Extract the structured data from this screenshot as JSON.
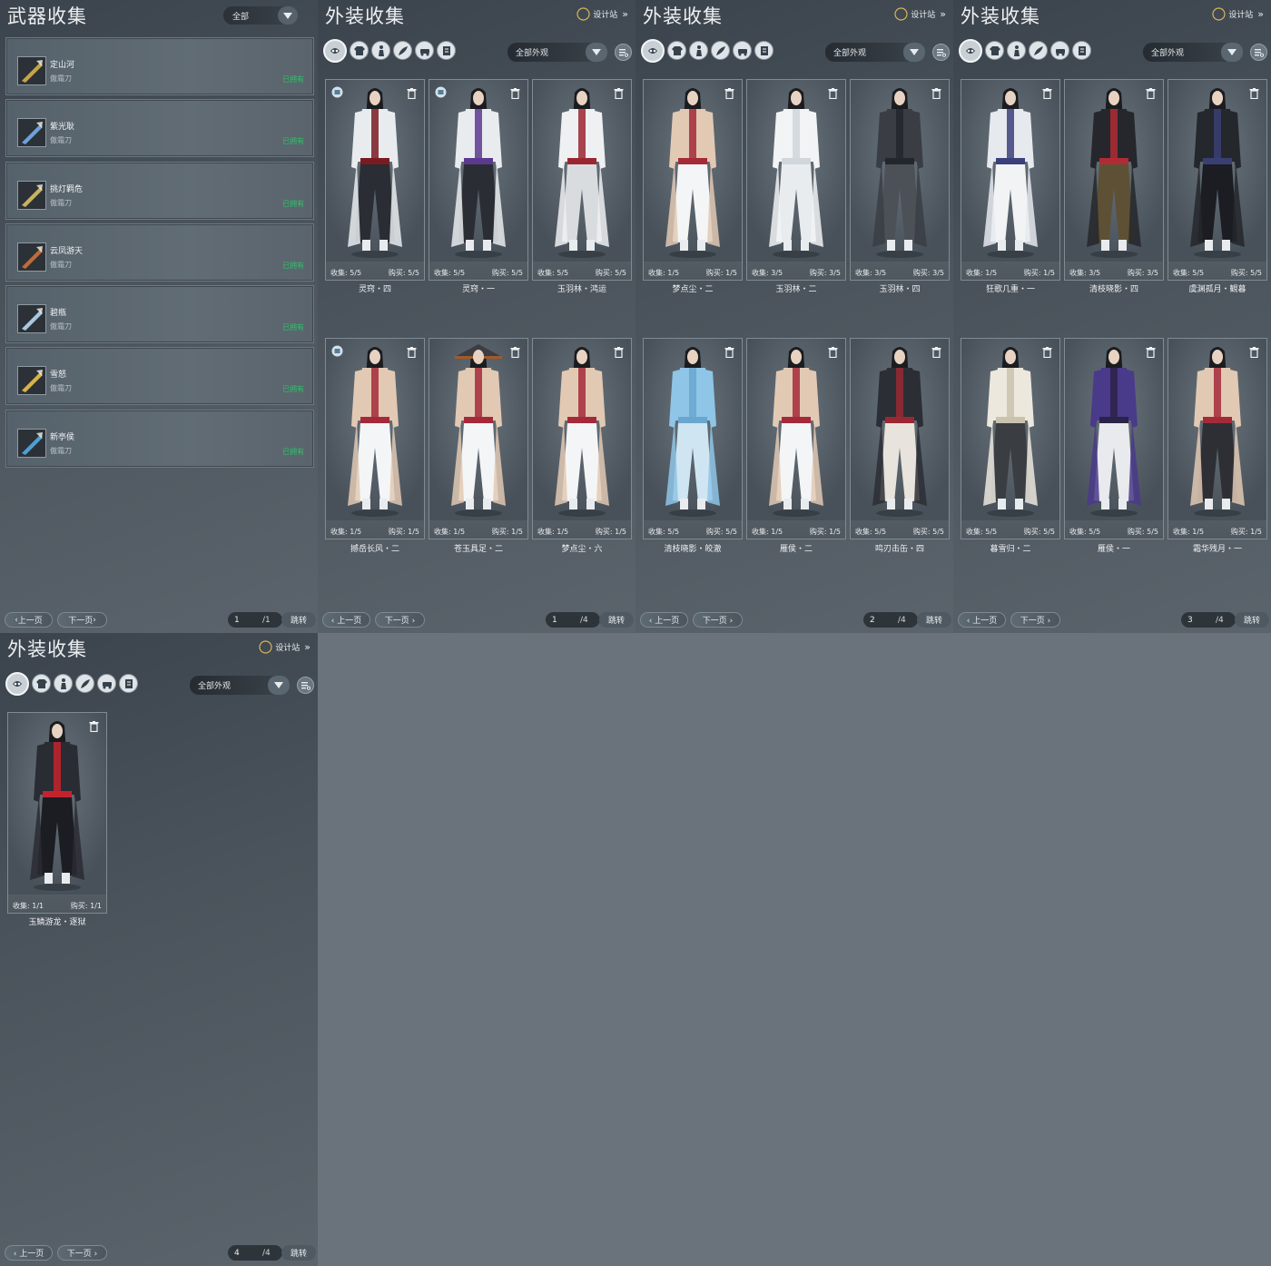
{
  "weapons_panel": {
    "title": "武器收集",
    "filter": "全部",
    "items": [
      {
        "name": "定山河",
        "type": "傲霜刀",
        "status": "已拥有"
      },
      {
        "name": "紫光耿",
        "type": "傲霜刀",
        "status": "已拥有"
      },
      {
        "name": "挑灯羁危",
        "type": "傲霜刀",
        "status": "已拥有"
      },
      {
        "name": "云凤游天",
        "type": "傲霜刀",
        "status": "已拥有"
      },
      {
        "name": "碧瓶",
        "type": "傲霜刀",
        "status": "已拥有"
      },
      {
        "name": "雪怒",
        "type": "傲霜刀",
        "status": "已拥有"
      },
      {
        "name": "新亭侯",
        "type": "傲霜刀",
        "status": "已拥有"
      }
    ],
    "pager": {
      "prev": "上一页",
      "next": "下一页",
      "current": "1",
      "total": "/1",
      "jump": "跳转"
    }
  },
  "outfit_common": {
    "title": "外装收集",
    "designer": "设计站",
    "filter": "全部外观",
    "collect_label": "收集:",
    "buy_label": "购买:",
    "prev": "上一页",
    "next": "下一页",
    "jump": "跳转"
  },
  "outfit_panels": [
    {
      "page": "1",
      "total": "/4",
      "cards": [
        {
          "name": "灵窍・四",
          "collect": "5/5",
          "buy": "5/5",
          "badge": true,
          "palette": [
            "#e9ecef",
            "#7a1b22",
            "#2a2d33"
          ]
        },
        {
          "name": "灵窍・一",
          "collect": "5/5",
          "buy": "5/5",
          "badge": true,
          "palette": [
            "#e9ecef",
            "#5b3a8e",
            "#2a2d33"
          ]
        },
        {
          "name": "玉羽林・鸿运",
          "collect": "5/5",
          "buy": "5/5",
          "badge": false,
          "palette": [
            "#eef0f2",
            "#9b2630",
            "#d9dcdf"
          ]
        },
        {
          "name": "撼岳长风・二",
          "collect": "1/5",
          "buy": "1/5",
          "badge": true,
          "palette": [
            "#e2c9b4",
            "#a42a3a",
            "#f4f5f6"
          ]
        },
        {
          "name": "苍玉具足・二",
          "collect": "1/5",
          "buy": "1/5",
          "badge": false,
          "palette": [
            "#e2c9b4",
            "#a42a3a",
            "#f4f5f6"
          ]
        },
        {
          "name": "梦点尘・六",
          "collect": "1/5",
          "buy": "1/5",
          "badge": false,
          "palette": [
            "#e2c9b4",
            "#a42a3a",
            "#f4f5f6"
          ]
        }
      ]
    },
    {
      "page": "2",
      "total": "/4",
      "cards": [
        {
          "name": "梦点尘・二",
          "collect": "1/5",
          "buy": "1/5",
          "badge": false,
          "palette": [
            "#e2c9b4",
            "#a42a3a",
            "#f4f5f6"
          ]
        },
        {
          "name": "玉羽林・二",
          "collect": "3/5",
          "buy": "3/5",
          "badge": false,
          "palette": [
            "#f1f3f5",
            "#cfd6dc",
            "#e9ecef"
          ]
        },
        {
          "name": "玉羽林・四",
          "collect": "3/5",
          "buy": "3/5",
          "badge": false,
          "palette": [
            "#3a3e44",
            "#23262b",
            "#4c5158"
          ]
        },
        {
          "name": "清枝晓影・皎澈",
          "collect": "5/5",
          "buy": "5/5",
          "badge": false,
          "palette": [
            "#8fc5e6",
            "#6aa6cf",
            "#cfe5f2"
          ]
        },
        {
          "name": "雁侯・二",
          "collect": "1/5",
          "buy": "1/5",
          "badge": false,
          "palette": [
            "#e2c9b4",
            "#a42a3a",
            "#f4f5f6"
          ]
        },
        {
          "name": "鸣刃击缶・四",
          "collect": "5/5",
          "buy": "5/5",
          "badge": false,
          "palette": [
            "#2b2e34",
            "#9a2832",
            "#e8e3dc"
          ]
        }
      ]
    },
    {
      "page": "3",
      "total": "/4",
      "cards": [
        {
          "name": "狂歌几重・一",
          "collect": "1/5",
          "buy": "1/5",
          "badge": false,
          "palette": [
            "#e6e9ee",
            "#3b3f7a",
            "#f2f3f5"
          ]
        },
        {
          "name": "清枝晓影・四",
          "collect": "3/5",
          "buy": "3/5",
          "badge": false,
          "palette": [
            "#25272c",
            "#b12b34",
            "#5d5034"
          ]
        },
        {
          "name": "虞渊孤月・観暮",
          "collect": "5/5",
          "buy": "5/5",
          "badge": false,
          "palette": [
            "#24272c",
            "#3a3f73",
            "#1b1d22"
          ]
        },
        {
          "name": "暮雪归・二",
          "collect": "5/5",
          "buy": "5/5",
          "badge": false,
          "palette": [
            "#ece8de",
            "#c9c2ad",
            "#3a3d42"
          ]
        },
        {
          "name": "雁侯・一",
          "collect": "5/5",
          "buy": "5/5",
          "badge": false,
          "palette": [
            "#4a3a8a",
            "#2b2348",
            "#e8eaee"
          ]
        },
        {
          "name": "霜华残月・一",
          "collect": "1/5",
          "buy": "1/5",
          "badge": false,
          "palette": [
            "#e2c9b4",
            "#a42a3a",
            "#2e2f35"
          ]
        }
      ]
    },
    {
      "page": "4",
      "total": "/4",
      "cards": [
        {
          "name": "玉鳞游龙・逐狱",
          "collect": "1/1",
          "buy": "1/1",
          "badge": false,
          "palette": [
            "#2a2c33",
            "#c4232d",
            "#1b1d22"
          ]
        }
      ]
    }
  ],
  "icons": {
    "tabs": [
      "mask-icon",
      "shirt-icon",
      "figure-icon",
      "feather-icon",
      "car-icon",
      "scroll-icon"
    ],
    "designer": "crescent-icon",
    "trash": "trash-icon",
    "settings": "settings-icon",
    "dropdown": "chevron-down-icon"
  }
}
